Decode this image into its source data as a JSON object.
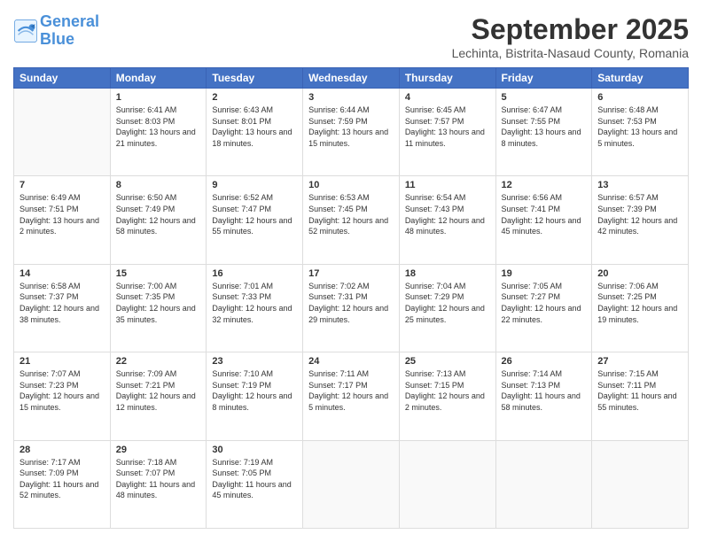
{
  "logo": {
    "line1": "General",
    "line2": "Blue"
  },
  "title": "September 2025",
  "location": "Lechinta, Bistrita-Nasaud County, Romania",
  "days_header": [
    "Sunday",
    "Monday",
    "Tuesday",
    "Wednesday",
    "Thursday",
    "Friday",
    "Saturday"
  ],
  "weeks": [
    [
      {
        "day": "",
        "sunrise": "",
        "sunset": "",
        "daylight": ""
      },
      {
        "day": "1",
        "sunrise": "Sunrise: 6:41 AM",
        "sunset": "Sunset: 8:03 PM",
        "daylight": "Daylight: 13 hours and 21 minutes."
      },
      {
        "day": "2",
        "sunrise": "Sunrise: 6:43 AM",
        "sunset": "Sunset: 8:01 PM",
        "daylight": "Daylight: 13 hours and 18 minutes."
      },
      {
        "day": "3",
        "sunrise": "Sunrise: 6:44 AM",
        "sunset": "Sunset: 7:59 PM",
        "daylight": "Daylight: 13 hours and 15 minutes."
      },
      {
        "day": "4",
        "sunrise": "Sunrise: 6:45 AM",
        "sunset": "Sunset: 7:57 PM",
        "daylight": "Daylight: 13 hours and 11 minutes."
      },
      {
        "day": "5",
        "sunrise": "Sunrise: 6:47 AM",
        "sunset": "Sunset: 7:55 PM",
        "daylight": "Daylight: 13 hours and 8 minutes."
      },
      {
        "day": "6",
        "sunrise": "Sunrise: 6:48 AM",
        "sunset": "Sunset: 7:53 PM",
        "daylight": "Daylight: 13 hours and 5 minutes."
      }
    ],
    [
      {
        "day": "7",
        "sunrise": "Sunrise: 6:49 AM",
        "sunset": "Sunset: 7:51 PM",
        "daylight": "Daylight: 13 hours and 2 minutes."
      },
      {
        "day": "8",
        "sunrise": "Sunrise: 6:50 AM",
        "sunset": "Sunset: 7:49 PM",
        "daylight": "Daylight: 12 hours and 58 minutes."
      },
      {
        "day": "9",
        "sunrise": "Sunrise: 6:52 AM",
        "sunset": "Sunset: 7:47 PM",
        "daylight": "Daylight: 12 hours and 55 minutes."
      },
      {
        "day": "10",
        "sunrise": "Sunrise: 6:53 AM",
        "sunset": "Sunset: 7:45 PM",
        "daylight": "Daylight: 12 hours and 52 minutes."
      },
      {
        "day": "11",
        "sunrise": "Sunrise: 6:54 AM",
        "sunset": "Sunset: 7:43 PM",
        "daylight": "Daylight: 12 hours and 48 minutes."
      },
      {
        "day": "12",
        "sunrise": "Sunrise: 6:56 AM",
        "sunset": "Sunset: 7:41 PM",
        "daylight": "Daylight: 12 hours and 45 minutes."
      },
      {
        "day": "13",
        "sunrise": "Sunrise: 6:57 AM",
        "sunset": "Sunset: 7:39 PM",
        "daylight": "Daylight: 12 hours and 42 minutes."
      }
    ],
    [
      {
        "day": "14",
        "sunrise": "Sunrise: 6:58 AM",
        "sunset": "Sunset: 7:37 PM",
        "daylight": "Daylight: 12 hours and 38 minutes."
      },
      {
        "day": "15",
        "sunrise": "Sunrise: 7:00 AM",
        "sunset": "Sunset: 7:35 PM",
        "daylight": "Daylight: 12 hours and 35 minutes."
      },
      {
        "day": "16",
        "sunrise": "Sunrise: 7:01 AM",
        "sunset": "Sunset: 7:33 PM",
        "daylight": "Daylight: 12 hours and 32 minutes."
      },
      {
        "day": "17",
        "sunrise": "Sunrise: 7:02 AM",
        "sunset": "Sunset: 7:31 PM",
        "daylight": "Daylight: 12 hours and 29 minutes."
      },
      {
        "day": "18",
        "sunrise": "Sunrise: 7:04 AM",
        "sunset": "Sunset: 7:29 PM",
        "daylight": "Daylight: 12 hours and 25 minutes."
      },
      {
        "day": "19",
        "sunrise": "Sunrise: 7:05 AM",
        "sunset": "Sunset: 7:27 PM",
        "daylight": "Daylight: 12 hours and 22 minutes."
      },
      {
        "day": "20",
        "sunrise": "Sunrise: 7:06 AM",
        "sunset": "Sunset: 7:25 PM",
        "daylight": "Daylight: 12 hours and 19 minutes."
      }
    ],
    [
      {
        "day": "21",
        "sunrise": "Sunrise: 7:07 AM",
        "sunset": "Sunset: 7:23 PM",
        "daylight": "Daylight: 12 hours and 15 minutes."
      },
      {
        "day": "22",
        "sunrise": "Sunrise: 7:09 AM",
        "sunset": "Sunset: 7:21 PM",
        "daylight": "Daylight: 12 hours and 12 minutes."
      },
      {
        "day": "23",
        "sunrise": "Sunrise: 7:10 AM",
        "sunset": "Sunset: 7:19 PM",
        "daylight": "Daylight: 12 hours and 8 minutes."
      },
      {
        "day": "24",
        "sunrise": "Sunrise: 7:11 AM",
        "sunset": "Sunset: 7:17 PM",
        "daylight": "Daylight: 12 hours and 5 minutes."
      },
      {
        "day": "25",
        "sunrise": "Sunrise: 7:13 AM",
        "sunset": "Sunset: 7:15 PM",
        "daylight": "Daylight: 12 hours and 2 minutes."
      },
      {
        "day": "26",
        "sunrise": "Sunrise: 7:14 AM",
        "sunset": "Sunset: 7:13 PM",
        "daylight": "Daylight: 11 hours and 58 minutes."
      },
      {
        "day": "27",
        "sunrise": "Sunrise: 7:15 AM",
        "sunset": "Sunset: 7:11 PM",
        "daylight": "Daylight: 11 hours and 55 minutes."
      }
    ],
    [
      {
        "day": "28",
        "sunrise": "Sunrise: 7:17 AM",
        "sunset": "Sunset: 7:09 PM",
        "daylight": "Daylight: 11 hours and 52 minutes."
      },
      {
        "day": "29",
        "sunrise": "Sunrise: 7:18 AM",
        "sunset": "Sunset: 7:07 PM",
        "daylight": "Daylight: 11 hours and 48 minutes."
      },
      {
        "day": "30",
        "sunrise": "Sunrise: 7:19 AM",
        "sunset": "Sunset: 7:05 PM",
        "daylight": "Daylight: 11 hours and 45 minutes."
      },
      {
        "day": "",
        "sunrise": "",
        "sunset": "",
        "daylight": ""
      },
      {
        "day": "",
        "sunrise": "",
        "sunset": "",
        "daylight": ""
      },
      {
        "day": "",
        "sunrise": "",
        "sunset": "",
        "daylight": ""
      },
      {
        "day": "",
        "sunrise": "",
        "sunset": "",
        "daylight": ""
      }
    ]
  ]
}
